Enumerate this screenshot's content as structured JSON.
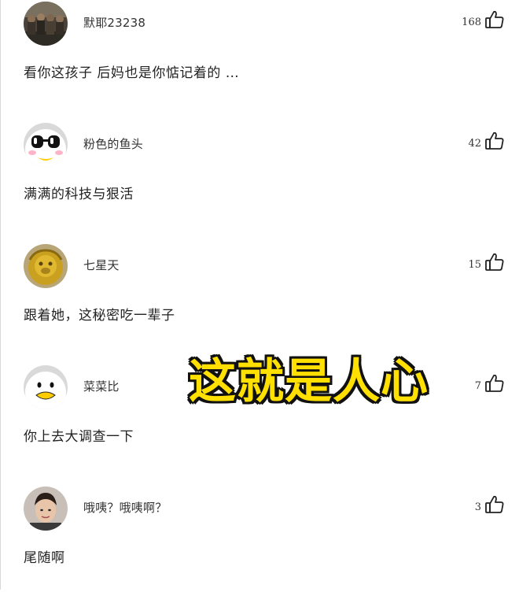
{
  "comments": [
    {
      "username": "默耶23238",
      "likes": "168",
      "text": "看你这孩子 后妈也是你惦记着的 …",
      "avatar": "group-photo-avatar"
    },
    {
      "username": "粉色的鱼头",
      "likes": "42",
      "text": "满满的科技与狠活",
      "avatar": "penguin-sunglasses-avatar"
    },
    {
      "username": "七星天",
      "likes": "15",
      "text": "跟着她，这秘密吃一辈子",
      "avatar": "golden-monkey-statue-avatar"
    },
    {
      "username": "菜菜比",
      "likes": "7",
      "text": "你上去大调查一下",
      "avatar": "penguin-cartoon-avatar"
    },
    {
      "username": "哦咦？哦咦啊？",
      "likes": "3",
      "text": "尾随啊",
      "avatar": "person-photo-avatar"
    }
  ],
  "overlay_caption": "这就是人心",
  "icons": {
    "like": "thumbs-up-icon"
  },
  "colors": {
    "caption_fill": "#ffe000",
    "caption_stroke": "#111111",
    "text": "#222222",
    "username": "#333333"
  }
}
